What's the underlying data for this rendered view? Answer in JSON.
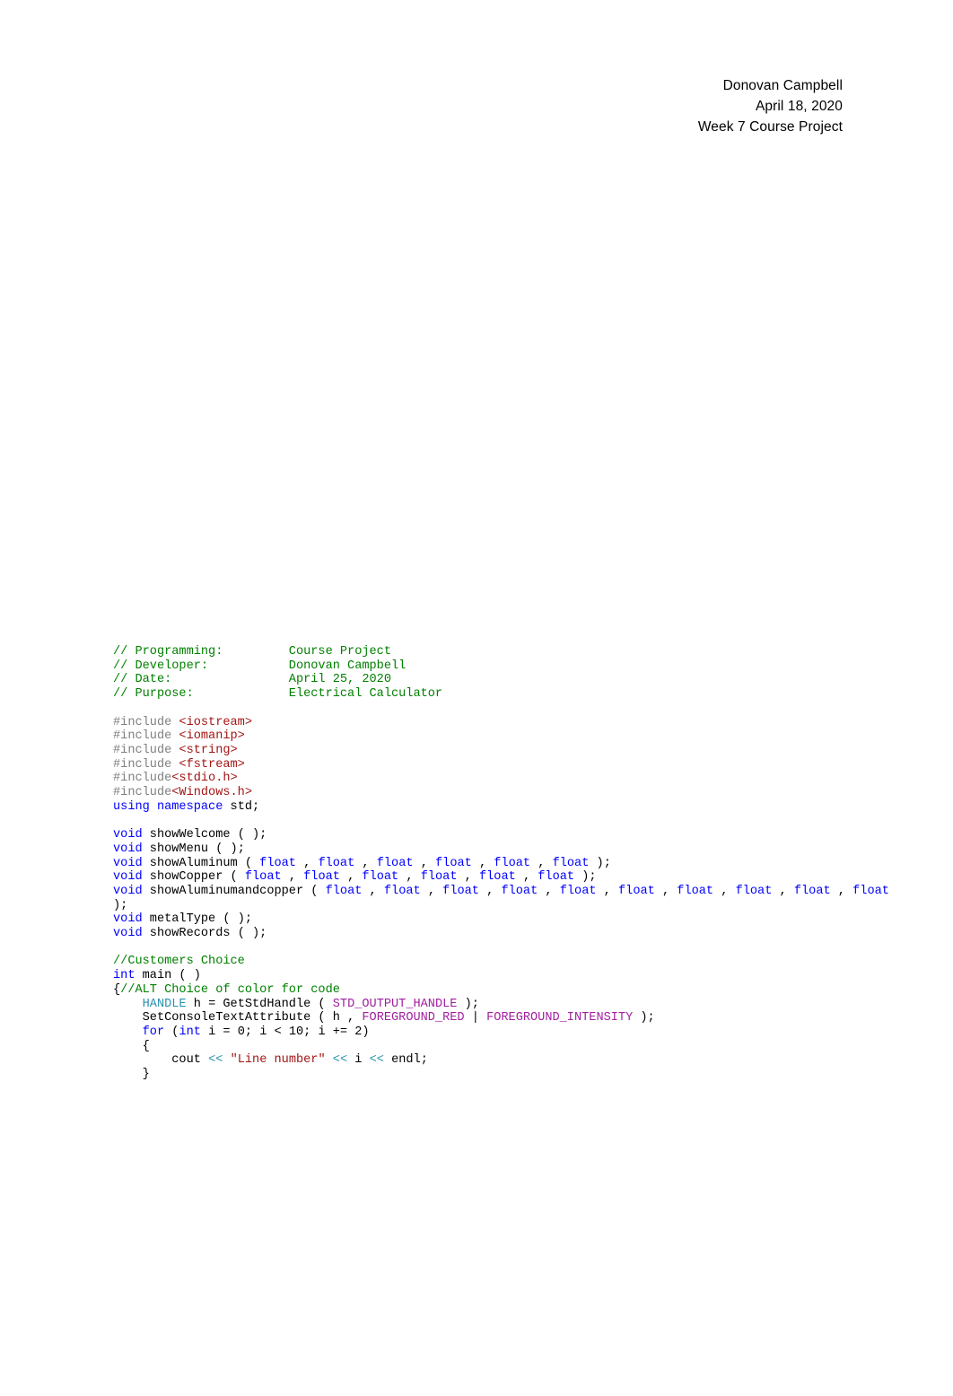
{
  "document": {
    "title": "Week 7 Course Project",
    "page_background": "#ffffff"
  },
  "header": {
    "lines": [
      "Donovan Campbell",
      "April 18, 2020",
      "Week 7 Course Project"
    ],
    "author": "Donovan Campbell",
    "date": "April 18, 2020",
    "assignment": "Week 7 Course Project"
  },
  "colors": {
    "comment": "#008000",
    "preprocessor": "#808080",
    "header_name": "#A31515",
    "string": "#A31515",
    "keyword": "#0000FF",
    "type": "#2B91AF",
    "operator": "#2B91AF",
    "macro": "#A020A0",
    "plain": "#000000",
    "page": "#ffffff"
  },
  "code": {
    "language": "cpp",
    "banner": {
      "programming_label": "// Programming:",
      "programming_value": "Course Project",
      "developer_label": "// Developer:",
      "developer_value": "Donovan Campbell",
      "date_label": "// Date:",
      "date_value": "April 25, 2020",
      "purpose_label": "// Purpose:",
      "purpose_value": "Electrical Calculator"
    },
    "includes": [
      "<iostream>",
      "<iomanip>",
      "<string>",
      "<fstream>",
      "<stdio.h>",
      "<Windows.h>"
    ],
    "lines": [
      {
        "id": "l01",
        "tokens": [
          {
            "t": "comment",
            "v": "// Programming:         Course Project"
          }
        ]
      },
      {
        "id": "l02",
        "tokens": [
          {
            "t": "comment",
            "v": "// Developer:           Donovan Campbell"
          }
        ]
      },
      {
        "id": "l03",
        "tokens": [
          {
            "t": "comment",
            "v": "// Date:                April 25, 2020"
          }
        ]
      },
      {
        "id": "l04",
        "tokens": [
          {
            "t": "comment",
            "v": "// Purpose:             Electrical Calculator"
          }
        ]
      },
      {
        "id": "l05",
        "tokens": [
          {
            "t": "plain",
            "v": " "
          }
        ]
      },
      {
        "id": "l06",
        "tokens": [
          {
            "t": "pre",
            "v": "#include "
          },
          {
            "t": "header",
            "v": "<iostream>"
          }
        ]
      },
      {
        "id": "l07",
        "tokens": [
          {
            "t": "pre",
            "v": "#include "
          },
          {
            "t": "header",
            "v": "<iomanip>"
          }
        ]
      },
      {
        "id": "l08",
        "tokens": [
          {
            "t": "pre",
            "v": "#include "
          },
          {
            "t": "header",
            "v": "<string>"
          }
        ]
      },
      {
        "id": "l09",
        "tokens": [
          {
            "t": "pre",
            "v": "#include "
          },
          {
            "t": "header",
            "v": "<fstream>"
          }
        ]
      },
      {
        "id": "l10",
        "tokens": [
          {
            "t": "pre",
            "v": "#include"
          },
          {
            "t": "header",
            "v": "<stdio.h>"
          }
        ]
      },
      {
        "id": "l11",
        "tokens": [
          {
            "t": "pre",
            "v": "#include"
          },
          {
            "t": "header",
            "v": "<Windows.h>"
          }
        ]
      },
      {
        "id": "l12",
        "tokens": [
          {
            "t": "keyword",
            "v": "using namespace "
          },
          {
            "t": "plain",
            "v": "std;"
          }
        ]
      },
      {
        "id": "l13",
        "tokens": [
          {
            "t": "plain",
            "v": " "
          }
        ]
      },
      {
        "id": "l14",
        "tokens": [
          {
            "t": "keyword",
            "v": "void"
          },
          {
            "t": "plain",
            "v": " showWelcome ( );"
          }
        ]
      },
      {
        "id": "l15",
        "tokens": [
          {
            "t": "keyword",
            "v": "void"
          },
          {
            "t": "plain",
            "v": " showMenu ( );"
          }
        ]
      },
      {
        "id": "l16",
        "tokens": [
          {
            "t": "keyword",
            "v": "void"
          },
          {
            "t": "plain",
            "v": " showAluminum ( "
          },
          {
            "t": "keyword",
            "v": "float"
          },
          {
            "t": "plain",
            "v": " , "
          },
          {
            "t": "keyword",
            "v": "float"
          },
          {
            "t": "plain",
            "v": " , "
          },
          {
            "t": "keyword",
            "v": "float"
          },
          {
            "t": "plain",
            "v": " , "
          },
          {
            "t": "keyword",
            "v": "float"
          },
          {
            "t": "plain",
            "v": " , "
          },
          {
            "t": "keyword",
            "v": "float"
          },
          {
            "t": "plain",
            "v": " , "
          },
          {
            "t": "keyword",
            "v": "float"
          },
          {
            "t": "plain",
            "v": " );"
          }
        ]
      },
      {
        "id": "l17",
        "tokens": [
          {
            "t": "keyword",
            "v": "void"
          },
          {
            "t": "plain",
            "v": " showCopper ( "
          },
          {
            "t": "keyword",
            "v": "float"
          },
          {
            "t": "plain",
            "v": " , "
          },
          {
            "t": "keyword",
            "v": "float"
          },
          {
            "t": "plain",
            "v": " , "
          },
          {
            "t": "keyword",
            "v": "float"
          },
          {
            "t": "plain",
            "v": " , "
          },
          {
            "t": "keyword",
            "v": "float"
          },
          {
            "t": "plain",
            "v": " , "
          },
          {
            "t": "keyword",
            "v": "float"
          },
          {
            "t": "plain",
            "v": " , "
          },
          {
            "t": "keyword",
            "v": "float"
          },
          {
            "t": "plain",
            "v": " );"
          }
        ]
      },
      {
        "id": "l18",
        "tokens": [
          {
            "t": "keyword",
            "v": "void"
          },
          {
            "t": "plain",
            "v": " showAluminumandcopper ( "
          },
          {
            "t": "keyword",
            "v": "float"
          },
          {
            "t": "plain",
            "v": " , "
          },
          {
            "t": "keyword",
            "v": "float"
          },
          {
            "t": "plain",
            "v": " , "
          },
          {
            "t": "keyword",
            "v": "float"
          },
          {
            "t": "plain",
            "v": " , "
          },
          {
            "t": "keyword",
            "v": "float"
          },
          {
            "t": "plain",
            "v": " , "
          },
          {
            "t": "keyword",
            "v": "float"
          },
          {
            "t": "plain",
            "v": " , "
          },
          {
            "t": "keyword",
            "v": "float"
          },
          {
            "t": "plain",
            "v": " , "
          },
          {
            "t": "keyword",
            "v": "float"
          },
          {
            "t": "plain",
            "v": " , "
          },
          {
            "t": "keyword",
            "v": "float"
          },
          {
            "t": "plain",
            "v": " , "
          },
          {
            "t": "keyword",
            "v": "float"
          },
          {
            "t": "plain",
            "v": " , "
          },
          {
            "t": "keyword",
            "v": "float"
          },
          {
            "t": "plain",
            "v": " );"
          }
        ]
      },
      {
        "id": "l19",
        "tokens": [
          {
            "t": "keyword",
            "v": "void"
          },
          {
            "t": "plain",
            "v": " metalType ( );"
          }
        ]
      },
      {
        "id": "l20",
        "tokens": [
          {
            "t": "keyword",
            "v": "void"
          },
          {
            "t": "plain",
            "v": " showRecords ( );"
          }
        ]
      },
      {
        "id": "l21",
        "tokens": [
          {
            "t": "plain",
            "v": " "
          }
        ]
      },
      {
        "id": "l22",
        "tokens": [
          {
            "t": "comment",
            "v": "//Customers Choice"
          }
        ]
      },
      {
        "id": "l23",
        "tokens": [
          {
            "t": "keyword",
            "v": "int"
          },
          {
            "t": "plain",
            "v": " main ( )"
          }
        ]
      },
      {
        "id": "l24",
        "tokens": [
          {
            "t": "plain",
            "v": "{"
          },
          {
            "t": "comment",
            "v": "//ALT Choice of color for code"
          }
        ]
      },
      {
        "id": "l25",
        "tokens": [
          {
            "t": "plain",
            "v": "    "
          },
          {
            "t": "type",
            "v": "HANDLE"
          },
          {
            "t": "plain",
            "v": " h = GetStdHandle ( "
          },
          {
            "t": "macro",
            "v": "STD_OUTPUT_HANDLE"
          },
          {
            "t": "plain",
            "v": " );"
          }
        ]
      },
      {
        "id": "l26",
        "tokens": [
          {
            "t": "plain",
            "v": "    SetConsoleTextAttribute ( h , "
          },
          {
            "t": "macro",
            "v": "FOREGROUND_RED"
          },
          {
            "t": "plain",
            "v": " | "
          },
          {
            "t": "macro",
            "v": "FOREGROUND_INTENSITY"
          },
          {
            "t": "plain",
            "v": " );"
          }
        ]
      },
      {
        "id": "l27",
        "tokens": [
          {
            "t": "plain",
            "v": "    "
          },
          {
            "t": "keyword",
            "v": "for"
          },
          {
            "t": "plain",
            "v": " ("
          },
          {
            "t": "keyword",
            "v": "int"
          },
          {
            "t": "plain",
            "v": " i = 0; i < 10; i += 2)"
          }
        ]
      },
      {
        "id": "l28",
        "tokens": [
          {
            "t": "plain",
            "v": "    {"
          }
        ]
      },
      {
        "id": "l29",
        "tokens": [
          {
            "t": "plain",
            "v": "        cout "
          },
          {
            "t": "op",
            "v": "<<"
          },
          {
            "t": "plain",
            "v": " "
          },
          {
            "t": "string",
            "v": "\"Line number\""
          },
          {
            "t": "plain",
            "v": " "
          },
          {
            "t": "op",
            "v": "<<"
          },
          {
            "t": "plain",
            "v": " i "
          },
          {
            "t": "op",
            "v": "<<"
          },
          {
            "t": "plain",
            "v": " endl;"
          }
        ]
      },
      {
        "id": "l30",
        "tokens": [
          {
            "t": "plain",
            "v": "    }"
          }
        ]
      }
    ]
  }
}
